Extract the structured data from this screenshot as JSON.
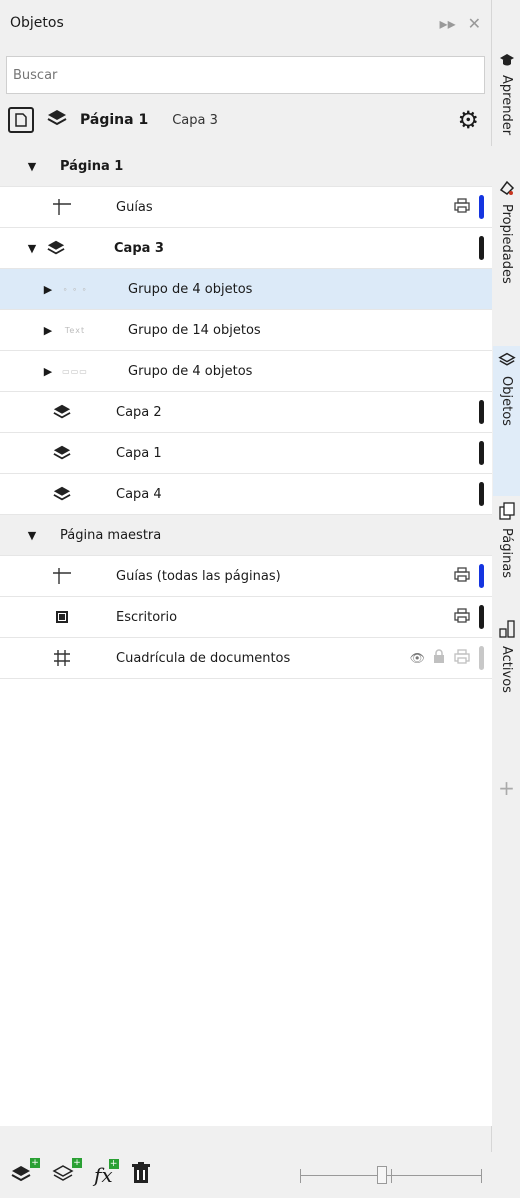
{
  "panel": {
    "title": "Objetos"
  },
  "search": {
    "placeholder": "Buscar"
  },
  "pagebar": {
    "page_name": "Página 1",
    "layer_name": "Capa 3"
  },
  "tree": [
    {
      "type": "section",
      "label": "Página 1",
      "bold": true
    },
    {
      "type": "item",
      "label": "Guías",
      "icon": "guides-icon",
      "print": true,
      "bar": "blue"
    },
    {
      "type": "layer",
      "label": "Capa 3",
      "bold": true,
      "expanded": true,
      "bar": "black"
    },
    {
      "type": "group",
      "label": "Grupo de 4 objetos",
      "selected": true,
      "thumb": "∘ ∘ ∘"
    },
    {
      "type": "group",
      "label": "Grupo de 14 objetos",
      "thumb": "Text"
    },
    {
      "type": "group",
      "label": "Grupo de 4 objetos",
      "thumb": "▭▭▭"
    },
    {
      "type": "item",
      "label": "Capa 2",
      "icon": "layer-icon",
      "bar": "black"
    },
    {
      "type": "item",
      "label": "Capa 1",
      "icon": "layer-icon",
      "bar": "black"
    },
    {
      "type": "item",
      "label": "Capa 4",
      "icon": "layer-icon",
      "bar": "black"
    },
    {
      "type": "section",
      "label": "Página maestra",
      "bold": false
    },
    {
      "type": "item",
      "label": "Guías (todas las páginas)",
      "icon": "guides-icon",
      "print": true,
      "bar": "blue"
    },
    {
      "type": "item",
      "label": "Escritorio",
      "icon": "desktop-icon",
      "print": true,
      "bar": "black"
    },
    {
      "type": "item",
      "label": "Cuadrícula de documentos",
      "icon": "grid-icon",
      "hidden": true,
      "locked": true,
      "print_faint": true,
      "bar": "grey"
    }
  ],
  "sidetabs": [
    {
      "label": "Aprender",
      "icon": "learn-icon"
    },
    {
      "label": "Propiedades",
      "icon": "properties-icon"
    },
    {
      "label": "Objetos",
      "icon": "objects-icon",
      "active": true
    },
    {
      "label": "Páginas",
      "icon": "pages-icon"
    },
    {
      "label": "Activos",
      "icon": "assets-icon"
    }
  ],
  "bottombar": {
    "slider_value": 0.45
  },
  "colors": {
    "selected_row": "#dceaf8",
    "blue_bar": "#1535e0",
    "green_badge": "#2aa034"
  }
}
